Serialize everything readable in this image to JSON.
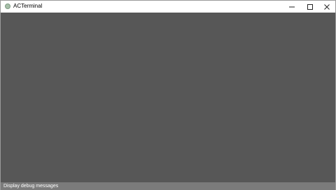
{
  "window": {
    "title": "ACTerminal",
    "icon": "app-icon"
  },
  "caption_buttons": {
    "minimize_icon": "minimize-icon",
    "maximize_icon": "maximize-icon",
    "close_icon": "close-icon"
  },
  "statusbar": {
    "label": "Display debug messages"
  },
  "colors": {
    "client_background": "#575757",
    "statusbar_background": "#7b7b7b"
  }
}
